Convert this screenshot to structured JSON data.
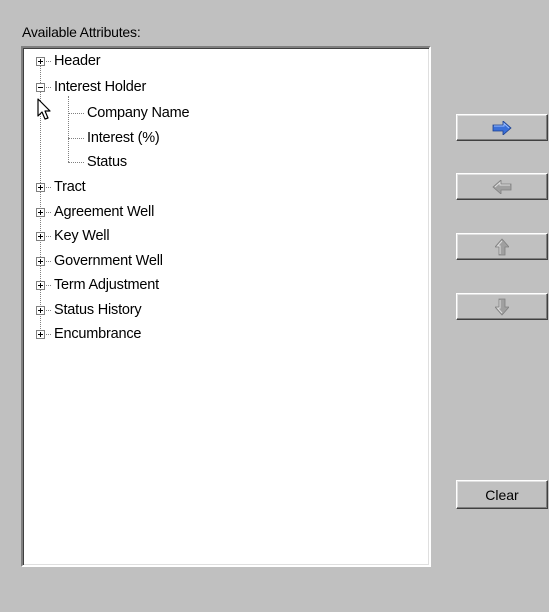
{
  "attributes_label": "Available Attributes:",
  "tree": {
    "header": "Header",
    "interest_holder": "Interest Holder",
    "company_name": "Company Name",
    "interest_pct": "Interest (%)",
    "status": "Status",
    "tract": "Tract",
    "agreement_well": "Agreement Well",
    "key_well": "Key Well",
    "government_well": "Government Well",
    "term_adjustment": "Term Adjustment",
    "status_history": "Status History",
    "encumbrance": "Encumbrance"
  },
  "buttons": {
    "clear": "Clear",
    "add_enabled": true,
    "remove_enabled": false,
    "up_enabled": false,
    "down_enabled": false
  },
  "colors": {
    "arrow_enabled": "#3a6fd8",
    "arrow_disabled": "#a0a0a0"
  },
  "icons": {
    "add": "arrow-right-icon",
    "remove": "arrow-left-icon",
    "up": "arrow-up-icon",
    "down": "arrow-down-icon",
    "expand": "plus-box-icon",
    "collapse": "minus-box-icon",
    "cursor": "mouse-pointer-icon"
  }
}
